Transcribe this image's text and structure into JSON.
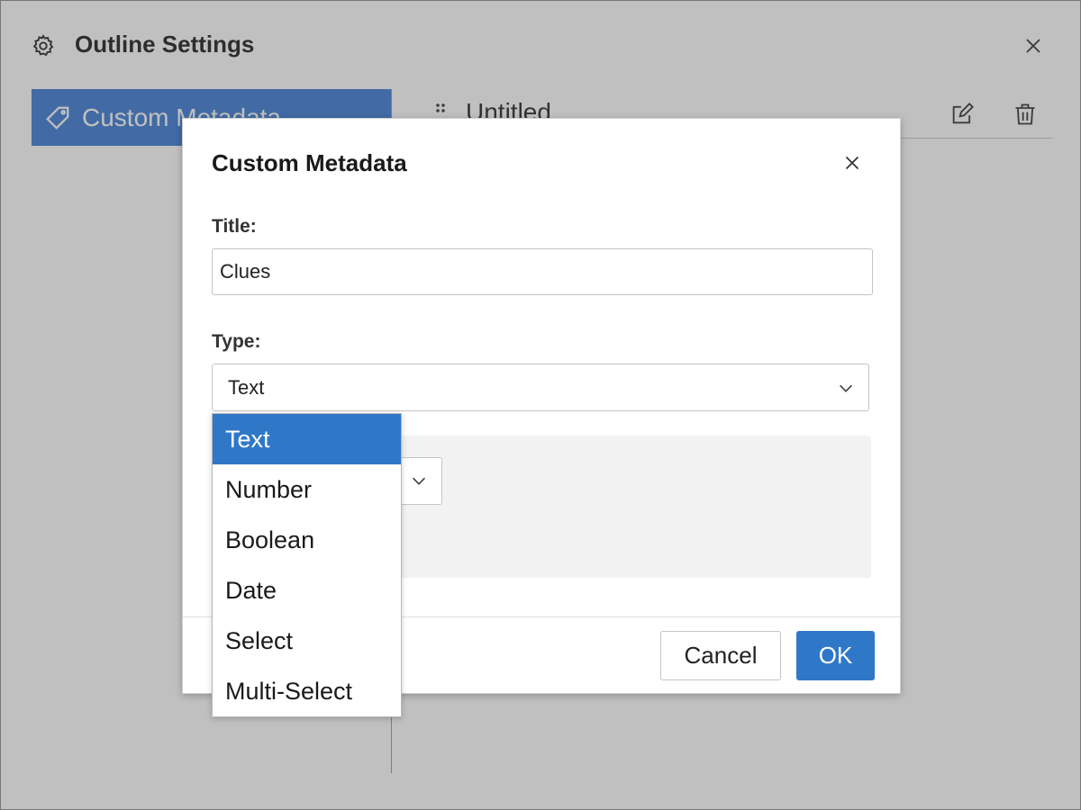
{
  "window": {
    "title": "Outline Settings",
    "title_icon": "gear-icon",
    "close_icon": "close-icon"
  },
  "sidebar": {
    "items": [
      {
        "label": "Custom Metadata",
        "icon": "tag-icon",
        "selected": true
      }
    ]
  },
  "content": {
    "row_title": "Untitled",
    "drag_icon": "drag-handle-icon",
    "edit_icon": "edit-icon",
    "delete_icon": "trash-icon"
  },
  "dialog": {
    "title": "Custom Metadata",
    "title_field_label": "Title:",
    "title_value": "Clues",
    "type_field_label": "Type:",
    "type_value": "Text",
    "cancel_label": "Cancel",
    "ok_label": "OK"
  },
  "dropdown": {
    "options": [
      "Text",
      "Number",
      "Boolean",
      "Date",
      "Select",
      "Multi-Select"
    ],
    "selected": "Text"
  },
  "colors": {
    "accent": "#2f78c8",
    "sidebar_selected": "#3a7bd5",
    "overlay": "#bfbfbf"
  }
}
